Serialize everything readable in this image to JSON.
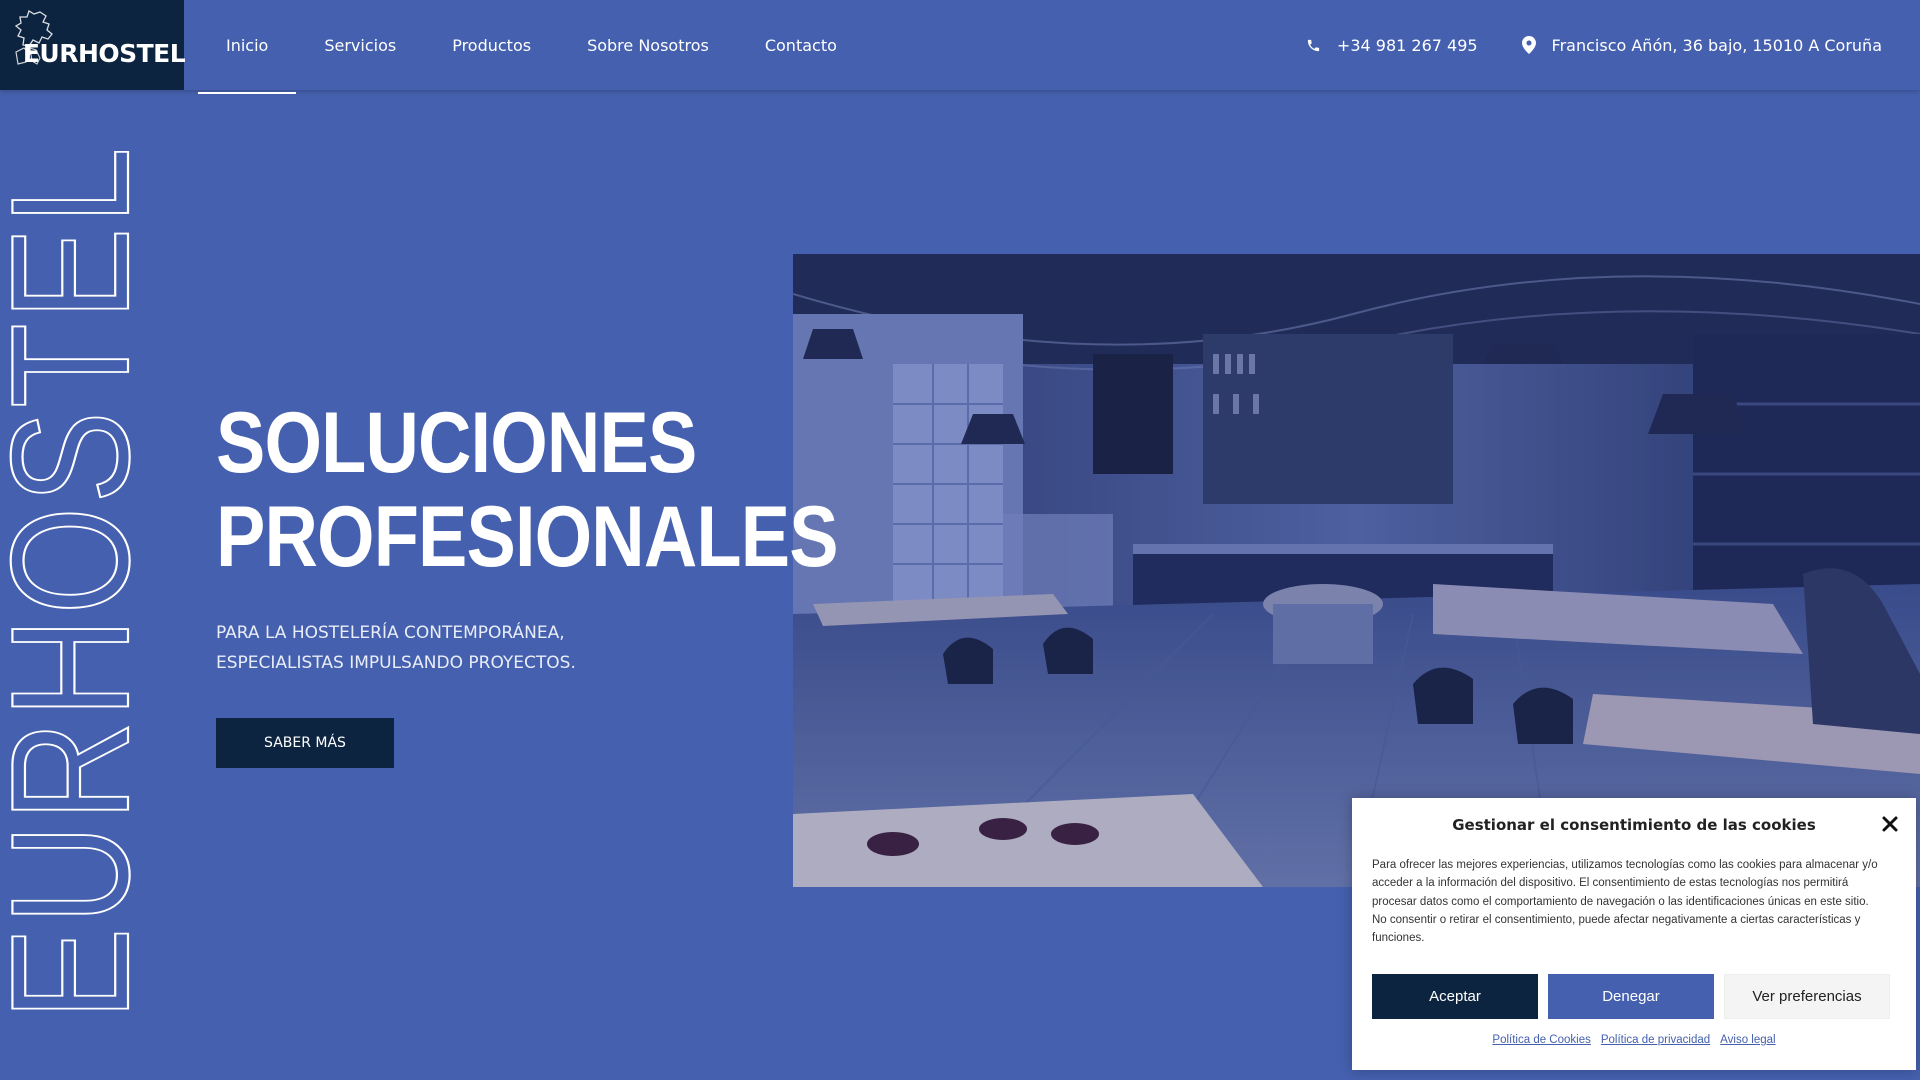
{
  "brand": {
    "logo_text": "EURHOSTEL",
    "vertical_text": "EURHOSTEL"
  },
  "nav": {
    "items": [
      {
        "label": "Inicio",
        "active": true
      },
      {
        "label": "Servicios",
        "active": false
      },
      {
        "label": "Productos",
        "active": false
      },
      {
        "label": "Sobre Nosotros",
        "active": false
      },
      {
        "label": "Contacto",
        "active": false
      }
    ]
  },
  "contact": {
    "phone": "+34 981 267 495",
    "address": "Francisco Añón, 36 bajo, 15010 A Coruña",
    "phone_icon": "phone-icon",
    "address_icon": "map-pin-icon"
  },
  "hero": {
    "title_line1": "SOLUCIONES",
    "title_line2": "PROFESIONALES",
    "subtitle_line1": "PARA LA HOSTELERÍA CONTEMPORÁNEA,",
    "subtitle_line2": "ESPECIALISTAS IMPULSANDO PROYECTOS.",
    "button_label": "SABER MÁS",
    "image_icon": "cafe-interior-photo"
  },
  "cookie_dialog": {
    "title": "Gestionar el consentimiento de las cookies",
    "text": "Para ofrecer las mejores experiencias, utilizamos tecnologías como las cookies para almacenar y/o acceder a la información del dispositivo. El consentimiento de estas tecnologías nos permitirá procesar datos como el comportamiento de navegación o las identificaciones únicas en este sitio. No consentir o retirar el consentimiento, puede afectar negativamente a ciertas características y funciones.",
    "accept_label": "Aceptar",
    "deny_label": "Denegar",
    "preferences_label": "Ver preferencias",
    "links": [
      "Política de Cookies",
      "Política de privacidad",
      "Aviso legal"
    ],
    "close_icon": "close-icon"
  },
  "colors": {
    "background": "#4560ae",
    "dark": "#0d2440",
    "white": "#ffffff"
  }
}
